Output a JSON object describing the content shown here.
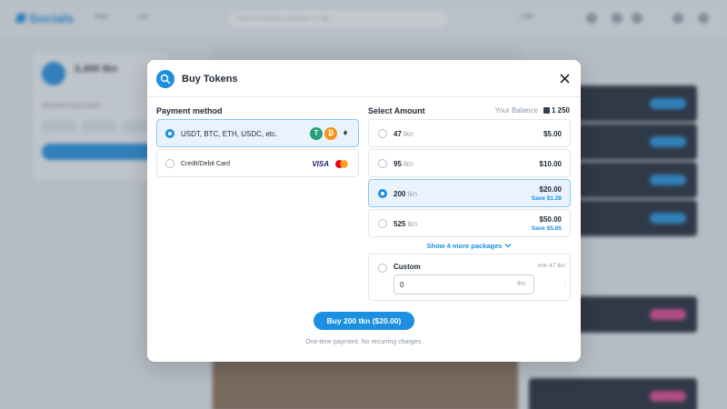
{
  "background": {
    "logo": "Socials",
    "chips": [
      "Feed",
      "Live"
    ],
    "search_placeholder": "Search for Models, Categories or Tags",
    "balance": "1 250",
    "wallet_balance": "2,400 tkn",
    "wallet_text": "Add funds to your wallet",
    "topup_label": "Top up balance"
  },
  "modal": {
    "title": "Buy Tokens",
    "payment_title": "Payment method",
    "amount_title": "Select Amount",
    "balance_label": "Your Balance",
    "balance_value": "1 250",
    "payment_methods": [
      {
        "label": "USDT, BTC, ETH, USDC, etc.",
        "selected": true,
        "icons": [
          "tether-icon",
          "bitcoin-icon",
          "ethereum-icon"
        ]
      },
      {
        "label": "Credit/Debit Card",
        "selected": false,
        "icons": [
          "visa-icon",
          "mastercard-icon"
        ],
        "visa_text": "VISA"
      }
    ],
    "packages": [
      {
        "tokens": "47",
        "unit": "tkn",
        "price": "$5.00",
        "save": "",
        "selected": false
      },
      {
        "tokens": "95",
        "unit": "tkn",
        "price": "$10.00",
        "save": "",
        "selected": false
      },
      {
        "tokens": "200",
        "unit": "tkn",
        "price": "$20.00",
        "save": "Save $1.28",
        "selected": true
      },
      {
        "tokens": "525",
        "unit": "tkn",
        "price": "$50.00",
        "save": "Save $5.85",
        "selected": false
      }
    ],
    "show_more": "Show 4 more packages",
    "custom": {
      "label": "Custom",
      "min": "min 47 tkn",
      "value": "0",
      "unit": "tkn"
    },
    "buy_button": "Buy 200 tkn ($20.00)",
    "note": "One-time payment. No recurring charges."
  },
  "colors": {
    "accent": "#1c8fe0",
    "selected_bg": "#e8f3fd",
    "tether": "#26a17b",
    "bitcoin": "#f7931a"
  }
}
